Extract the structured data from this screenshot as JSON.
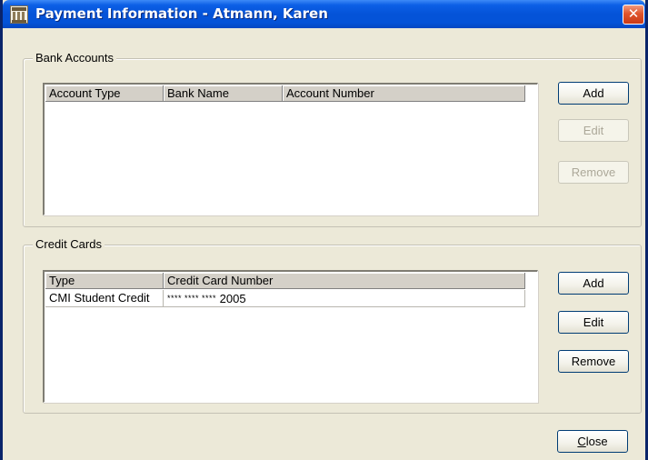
{
  "window": {
    "title": "Payment Information - Atmann, Karen",
    "close_glyph": "✕"
  },
  "bank_accounts": {
    "legend": "Bank Accounts",
    "columns": [
      "Account Type",
      "Bank Name",
      "Account Number"
    ],
    "rows": [],
    "buttons": {
      "add": "Add",
      "edit": "Edit",
      "remove": "Remove"
    }
  },
  "credit_cards": {
    "legend": "Credit Cards",
    "columns": [
      "Type",
      "Credit Card Number"
    ],
    "rows": [
      {
        "type": "CMI Student Credit",
        "mask": "**** **** ****",
        "last4": "2005"
      }
    ],
    "buttons": {
      "add": "Add",
      "edit": "Edit",
      "remove": "Remove"
    }
  },
  "footer": {
    "close_label_first": "C",
    "close_label_rest": "lose"
  },
  "colors": {
    "titlebar": "#0453d8",
    "window_face": "#ece9d8",
    "disabled_text": "#aca899"
  },
  "icons": {
    "app": "building-icon",
    "close": "close-icon"
  }
}
